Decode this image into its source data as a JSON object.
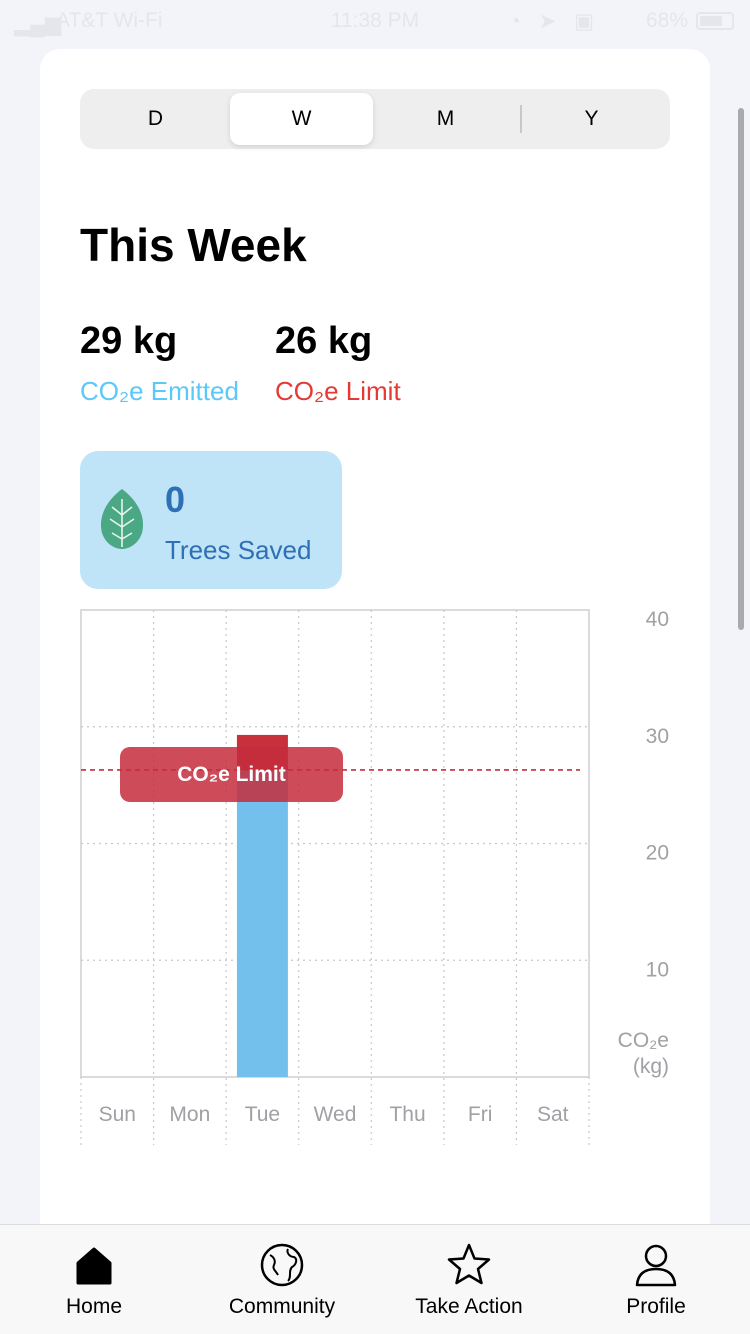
{
  "status_bar": {
    "carrier": "AT&T Wi-Fi",
    "time": "11:38 PM",
    "battery": "68%"
  },
  "segments": [
    {
      "label": "D",
      "active": false
    },
    {
      "label": "W",
      "active": true
    },
    {
      "label": "M",
      "active": false
    },
    {
      "label": "Y",
      "active": false
    }
  ],
  "summary": {
    "title": "This Week",
    "emitted_value": "29 kg",
    "emitted_label": "CO₂e Emitted",
    "limit_value": "26 kg",
    "limit_label": "CO₂e Limit"
  },
  "trees": {
    "count": "0",
    "label": "Trees Saved"
  },
  "colors": {
    "emitted": "#5ac8fa",
    "limit": "#e53935",
    "bar": "#74c0ec",
    "bar_over": "#c8303c",
    "trees_bg": "#bfe3f7",
    "trees_text": "#2f6fb5"
  },
  "chart_data": {
    "type": "bar",
    "categories": [
      "Sun",
      "Mon",
      "Tue",
      "Wed",
      "Thu",
      "Fri",
      "Sat"
    ],
    "values": [
      0,
      0,
      29.3,
      0,
      0,
      0,
      0
    ],
    "limit": 26.3,
    "limit_label": "CO₂e Limit",
    "ylabel": "CO₂e\n(kg)",
    "ylabel_line1": "CO₂e",
    "ylabel_line2": "(kg)",
    "yticks": [
      "40",
      "30",
      "20",
      "10"
    ],
    "ylim": [
      0,
      40
    ],
    "grid": true
  },
  "tabbar": {
    "items": [
      {
        "label": "Home",
        "icon": "house-icon"
      },
      {
        "label": "Community",
        "icon": "globe-icon"
      },
      {
        "label": "Take Action",
        "icon": "star-icon"
      },
      {
        "label": "Profile",
        "icon": "person-icon"
      }
    ]
  }
}
